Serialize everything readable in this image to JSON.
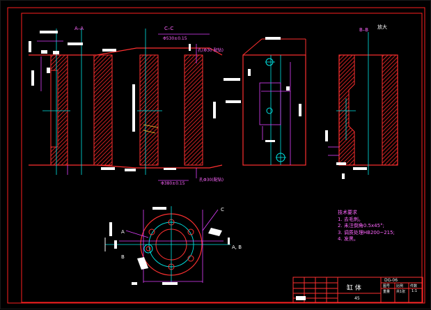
{
  "drawing": {
    "section_labels": [
      "A–A",
      "C–C",
      "B–B"
    ],
    "view_label": "放大",
    "dim_top_cc": "Φ530±0.15",
    "dim_bottom_cc": "Φ380±0.15",
    "bore_note_top": "孔(Φ30 配钻)",
    "bore_note_bottom": "孔Φ30(配钻)",
    "arrow_c": "C",
    "arrow_a": "A",
    "arrow_b": "B",
    "arrow_ab": "A, B"
  },
  "tech_requirements": {
    "title": "技术要求",
    "items": [
      "1. 去毛刺。",
      "2. 未注倒角0.5x45°;",
      "3. 调质处理HB200~215;",
      "4. 发黑。"
    ]
  },
  "title_block": {
    "part_name": "缸  体",
    "drawing_no": "DG-06",
    "material": "45",
    "cells": [
      "图号",
      "比例",
      "件数",
      "重量",
      "共1张",
      "1:1"
    ]
  },
  "colors": {
    "frame": "#ff2020",
    "outline": "#ff3030",
    "hatch": "#ff2222",
    "centerline": "#00e5e5",
    "dimension": "#e040ff",
    "text": "#ffffff"
  }
}
